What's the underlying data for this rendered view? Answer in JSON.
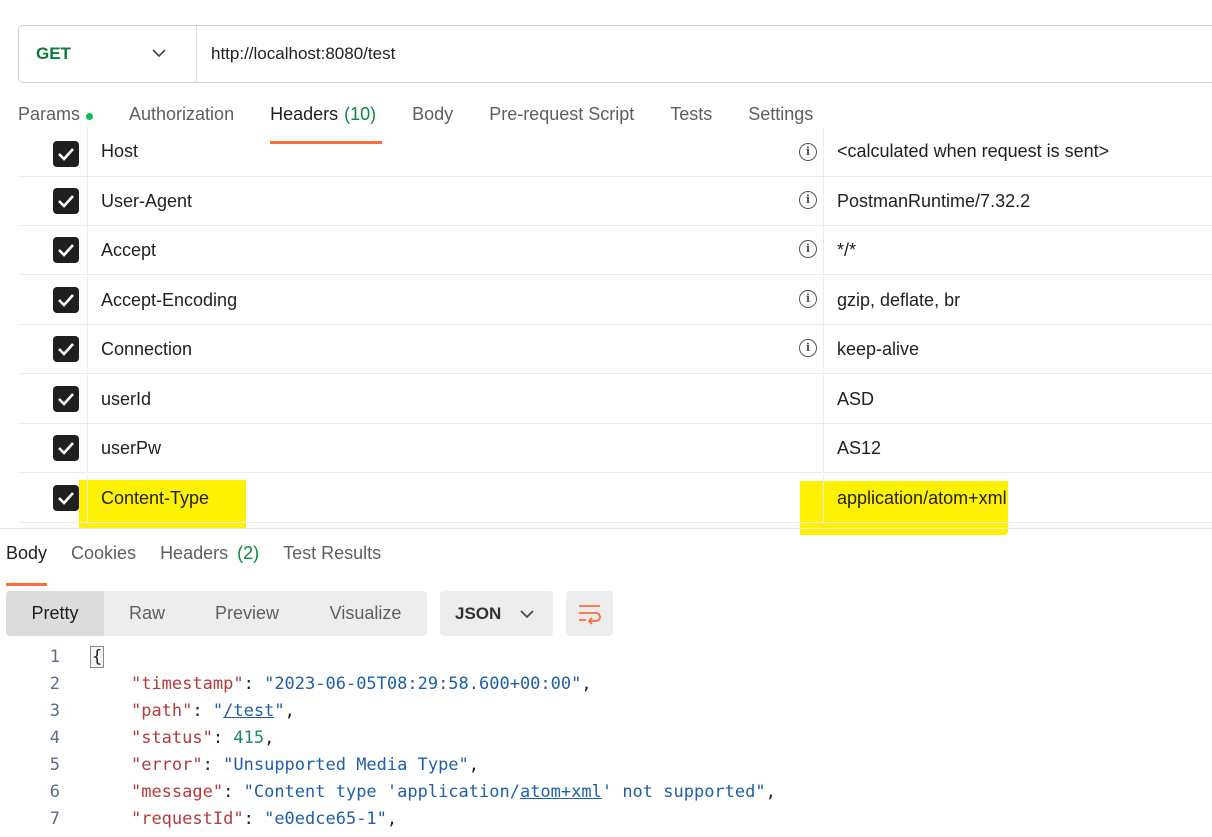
{
  "request": {
    "method": "GET",
    "url": "http://localhost:8080/test"
  },
  "request_tabs": [
    {
      "label": "Params",
      "count": "",
      "has_dot": true
    },
    {
      "label": "Authorization",
      "count": ""
    },
    {
      "label": "Headers",
      "count": "(10)",
      "active": true
    },
    {
      "label": "Body",
      "count": ""
    },
    {
      "label": "Pre-request Script",
      "count": ""
    },
    {
      "label": "Tests",
      "count": ""
    },
    {
      "label": "Settings",
      "count": ""
    }
  ],
  "headers": [
    {
      "key": "Host",
      "value": "<calculated when request is sent>",
      "checked": true,
      "info": true
    },
    {
      "key": "User-Agent",
      "value": "PostmanRuntime/7.32.2",
      "checked": true,
      "info": true
    },
    {
      "key": "Accept",
      "value": "*/*",
      "checked": true,
      "info": true
    },
    {
      "key": "Accept-Encoding",
      "value": "gzip, deflate, br",
      "checked": true,
      "info": true
    },
    {
      "key": "Connection",
      "value": "keep-alive",
      "checked": true,
      "info": true
    },
    {
      "key": "userId",
      "value": "ASD",
      "checked": true,
      "info": false
    },
    {
      "key": "userPw",
      "value": "AS12",
      "checked": true,
      "info": false
    },
    {
      "key": "Content-Type",
      "value": "application/atom+xml",
      "checked": true,
      "info": false,
      "highlighted": true
    }
  ],
  "info_glyph": "i",
  "response_tabs": [
    {
      "label": "Body",
      "count": "",
      "active": true
    },
    {
      "label": "Cookies",
      "count": ""
    },
    {
      "label": "Headers",
      "count": "(2)"
    },
    {
      "label": "Test Results",
      "count": ""
    }
  ],
  "view_modes": [
    "Pretty",
    "Raw",
    "Preview",
    "Visualize"
  ],
  "format": "JSON",
  "code_lines": [
    {
      "n": "1",
      "text": "{"
    },
    {
      "n": "2",
      "key": "timestamp",
      "value": "2023-06-05T08:29:58.600+00:00",
      "kind": "string"
    },
    {
      "n": "3",
      "key": "path",
      "value": "/test",
      "kind": "link"
    },
    {
      "n": "4",
      "key": "status",
      "value": "415",
      "kind": "number"
    },
    {
      "n": "5",
      "key": "error",
      "value": "Unsupported Media Type",
      "kind": "string"
    },
    {
      "n": "6",
      "key": "message",
      "value_pre": "Content type 'application/",
      "value_link": "atom+xml",
      "value_post": "' not supported",
      "kind": "mixed"
    },
    {
      "n": "7",
      "key": "requestId",
      "value": "e0edce65-1",
      "kind": "string"
    }
  ],
  "colors": {
    "accent": "#ff6c37",
    "method_get": "#0a7a3c",
    "highlight": "#fff200",
    "json_key": "#b53a3a",
    "json_string": "#1f5fa8",
    "json_number": "#1e8a5a"
  }
}
